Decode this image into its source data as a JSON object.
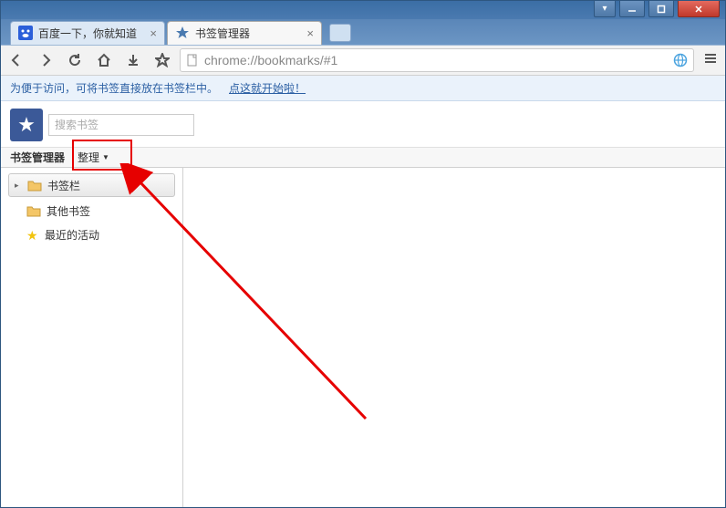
{
  "window_controls": {
    "dropdown": "▾",
    "minimize": "—",
    "maximize": "▢",
    "close": "✕"
  },
  "tabs": [
    {
      "title": "百度一下，你就知道",
      "favicon": "baidu"
    },
    {
      "title": "书签管理器",
      "favicon": "star"
    }
  ],
  "toolbar": {
    "url": "chrome://bookmarks/#1"
  },
  "infobar": {
    "text": "为便于访问，可将书签直接放在书签栏中。",
    "link": "点这就开始啦！"
  },
  "bookmark_manager": {
    "search_placeholder": "搜索书签",
    "manager_label": "书签管理器",
    "organize_label": "整理",
    "tree": [
      {
        "label": "书签栏",
        "icon": "folder",
        "selected": true,
        "expandable": true
      },
      {
        "label": "其他书签",
        "icon": "folder",
        "selected": false,
        "expandable": false
      },
      {
        "label": "最近的活动",
        "icon": "star",
        "selected": false,
        "expandable": false
      }
    ]
  }
}
